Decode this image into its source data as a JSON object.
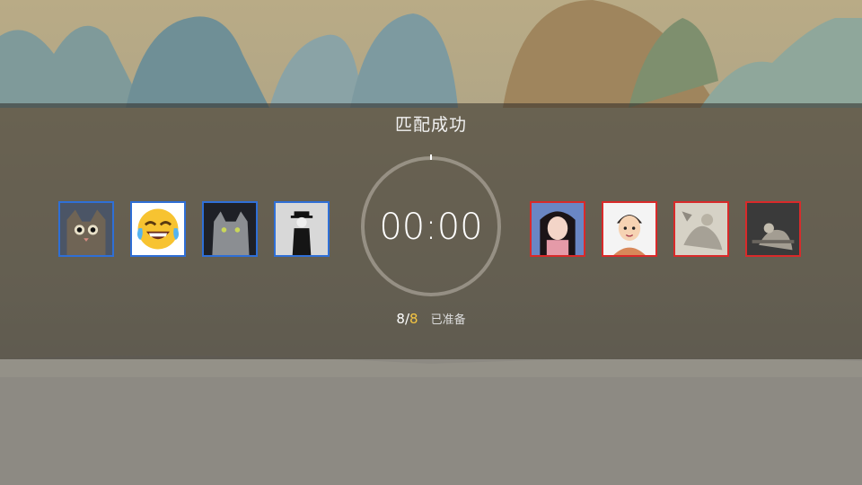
{
  "match": {
    "title": "匹配成功",
    "timer": "00:00",
    "ready_current": "8",
    "ready_separator": "/",
    "ready_total": "8",
    "ready_label": "已准备"
  },
  "colors": {
    "team_blue": "#2f6fd6",
    "team_red": "#d92a2a",
    "ready_total": "#f5c542"
  },
  "team_blue": [
    {
      "icon": "cat-avatar"
    },
    {
      "icon": "crying-laughing-emoji-avatar"
    },
    {
      "icon": "gray-cat-avatar"
    },
    {
      "icon": "man-in-hat-avatar"
    }
  ],
  "team_red": [
    {
      "icon": "anime-girl-avatar"
    },
    {
      "icon": "cartoon-boy-avatar"
    },
    {
      "icon": "sketch-avatar"
    },
    {
      "icon": "dark-sketch-avatar"
    }
  ]
}
